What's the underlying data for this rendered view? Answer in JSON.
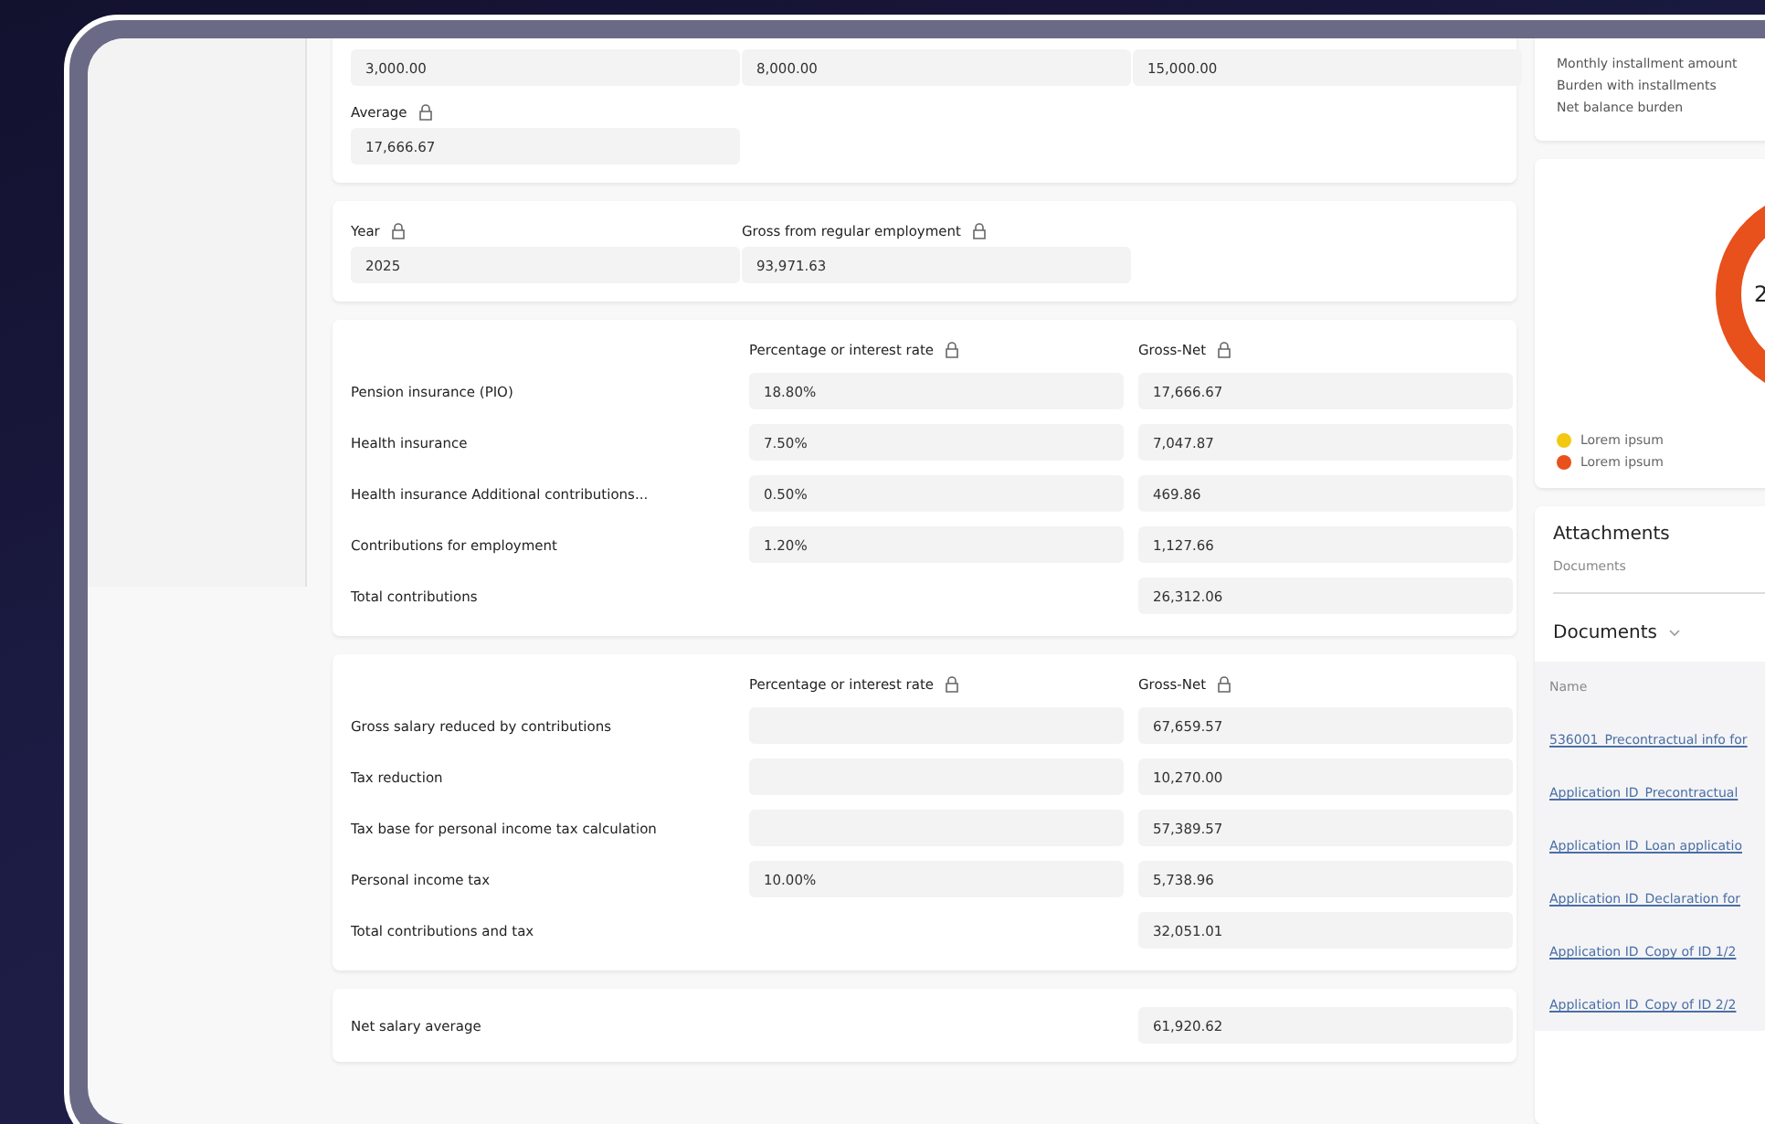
{
  "income": {
    "values": [
      "3,000.00",
      "8,000.00",
      "15,000.00"
    ],
    "average": {
      "label": "Average",
      "value": "17,666.67"
    }
  },
  "year_card": {
    "fields": [
      {
        "label": "Year",
        "value": "2025"
      },
      {
        "label": "Gross from regular employment",
        "value": "93,971.63"
      }
    ]
  },
  "tables": [
    {
      "columns": [
        "Percentage or interest rate",
        "Gross-Net"
      ],
      "rows": [
        {
          "kind": "rate",
          "label": "Pension insurance (PIO)",
          "rate": "18.80%",
          "amount": "17,666.67"
        },
        {
          "kind": "rate",
          "label": "Health insurance",
          "rate": "7.50%",
          "amount": "7,047.87"
        },
        {
          "kind": "rate",
          "label": "Health insurance Additional contributions...",
          "rate": "0.50%",
          "amount": "469.86"
        },
        {
          "kind": "rate",
          "label": "Contributions for employment",
          "rate": "1.20%",
          "amount": "1,127.66"
        },
        {
          "kind": "total",
          "label": "Total contributions",
          "amount": "26,312.06"
        }
      ]
    },
    {
      "columns": [
        "Percentage or interest rate",
        "Gross-Net"
      ],
      "rows": [
        {
          "kind": "blank",
          "label": "Gross salary reduced by contributions",
          "amount": "67,659.57"
        },
        {
          "kind": "blank",
          "label": "Tax reduction",
          "amount": "10,270.00"
        },
        {
          "kind": "blank",
          "label": "Tax base for personal income tax calculation",
          "amount": "57,389.57"
        },
        {
          "kind": "rate",
          "label": "Personal income tax",
          "rate": "10.00%",
          "amount": "5,738.96"
        },
        {
          "kind": "total",
          "label": "Total contributions and tax",
          "amount": "32,051.01"
        }
      ]
    }
  ],
  "net": {
    "label": "Net salary average",
    "value": "61,920.62"
  },
  "installments": [
    "Monthly installment amount",
    "Burden with installments",
    "Net balance burden"
  ],
  "donut": {
    "center": "2",
    "legend": [
      {
        "label": "Lorem ipsum",
        "color": "#f2c811"
      },
      {
        "label": "Lorem ipsum",
        "color": "#e8501c"
      }
    ]
  },
  "attachments": {
    "title": "Attachments",
    "subtitle": "Documents",
    "section": "Documents",
    "column": "Name",
    "links": [
      "536001_Precontractual info for",
      "Application ID_Precontractual",
      "Application ID_Loan applicatio",
      "Application ID_Declaration for",
      "Application ID_Copy of ID 1/2",
      "Application ID_Copy of ID 2/2"
    ]
  }
}
